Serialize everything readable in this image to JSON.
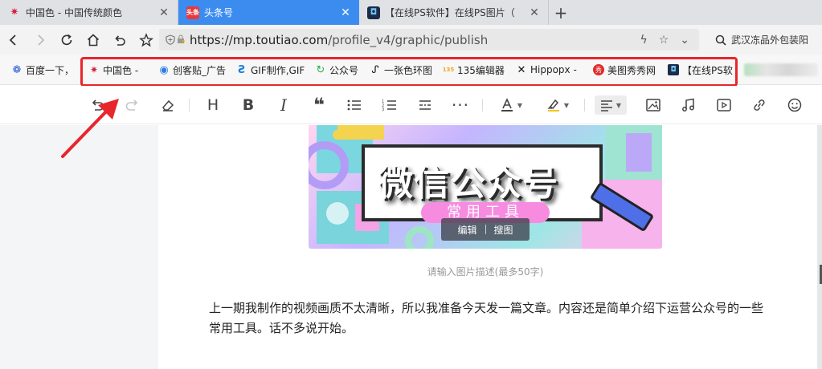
{
  "tabs": [
    {
      "title": "中国色 - 中国传统颜色",
      "favicon": "chinese-color-icon",
      "active": false
    },
    {
      "title": "头条号",
      "favicon": "toutiao-icon",
      "favicon_text": "头条",
      "active": true
    },
    {
      "title": "【在线PS软件】在线PS图片（",
      "favicon": "online-ps-icon",
      "active": false
    }
  ],
  "address": {
    "url_main": "https://mp.toutiao.com",
    "url_path": "/profile_v4/graphic/publish"
  },
  "search": {
    "text": "武汉冻品外包装阳"
  },
  "bookmarks": [
    {
      "label": "百度一下，",
      "icon": "baidu-paw-icon"
    },
    {
      "label": "中国色 -",
      "icon": "chinese-color-icon"
    },
    {
      "label": "创客贴_广告",
      "icon": "chuangkit-icon"
    },
    {
      "label": "GIF制作,GIF",
      "icon": "gif-maker-icon"
    },
    {
      "label": "公众号",
      "icon": "wechat-official-icon"
    },
    {
      "label": "一张色环图",
      "icon": "color-wheel-icon"
    },
    {
      "label": "135编辑器",
      "icon": "editor-135-icon",
      "icon_text": "135"
    },
    {
      "label": "Hippopx -",
      "icon": "hippopx-icon"
    },
    {
      "label": "美图秀秀网",
      "icon": "meitu-icon",
      "icon_text": "秀"
    },
    {
      "label": "【在线PS软",
      "icon": "online-ps-icon"
    }
  ],
  "editor": {
    "image_title": "微信公众号",
    "image_subtitle": "常用工具",
    "image_edit": "编辑",
    "image_search": "搜图",
    "caption_placeholder": "请输入图片描述(最多50字)",
    "paragraph": "上一期我制作的视频画质不太清晰，所以我准备今天发一篇文章。内容还是简单介绍下运营公众号的一些常用工具。话不多说开始。"
  },
  "colors": {
    "active_tab": "#3c8cf0",
    "highlight_box": "#e8262b",
    "arrow": "#e8262b"
  }
}
